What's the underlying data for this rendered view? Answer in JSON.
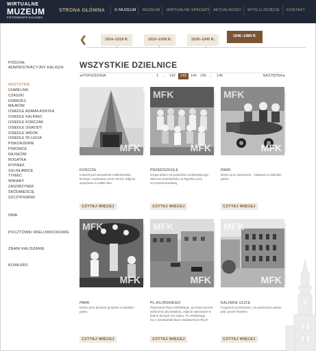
{
  "header": {
    "logo": {
      "line1": "WIRTUALNE",
      "line2": "MUZEUM",
      "line3": "FOTOGRAFII KALISZA"
    },
    "home_label": "STRONA GŁÓWNA",
    "nav": [
      {
        "label": "O MUZEUM",
        "active": true
      },
      {
        "label": "MUZEUM",
        "active": false
      },
      {
        "label": "WIRTUALNE SPACERY",
        "active": false
      },
      {
        "label": "AKTUALNOŚCI",
        "active": false
      },
      {
        "label": "WYŚLIJ ZDJĘCIE",
        "active": false
      },
      {
        "label": "KONTAKT",
        "active": false
      }
    ]
  },
  "timeline": {
    "tabs": [
      "1914–1918 R.",
      "1919–1938 R.",
      "1939–1945 R.",
      "1946–1989 R."
    ],
    "active_index": 3
  },
  "sidebar": {
    "heading": [
      "PODZIAŁ",
      "ADMINISTRACYJNY KALISZA"
    ],
    "districts": [
      "WSZYSTKIE",
      "CHMIELNIK",
      "CZASZKI",
      "DOBRZEC",
      "MAJKÓW",
      "OSIEDLE ADAMA ASNYKA",
      "OSIEDLE KALINIEC",
      "OSIEDLE KORCZAK",
      "OSIEDLE OGRODY",
      "OSIEDLE WIDOK",
      "OSIEDLE 25-LECIA",
      "PISKORZEWIE",
      "PIWONICE",
      "RAJSKÓW",
      "ROGATKA",
      "RYPINEK",
      "SULISŁAWICE",
      "TYNIEC",
      "WINIARY",
      "ZAGORZYNEK",
      "ŚRÓDMIEŚCIE",
      "SZCZYPIORNO"
    ],
    "active_district": "WSZYSTKIE",
    "links": [
      "INNE",
      "POCZTÓWKI WIELOWIDOKOWE",
      "ZNANI KALISZANIE",
      "KONKURS"
    ]
  },
  "main": {
    "title": "WSZYSTKIE DZIELNICE",
    "pager": {
      "prev": "◂ POPRZEDNIA",
      "next": "NASTĘPNA ▸",
      "pages": [
        "1",
        "...",
        "142",
        "143",
        "144",
        "145",
        "...",
        "146"
      ],
      "current": "143"
    },
    "watermark": "MFK",
    "button_label": "CZYTAJ WIĘCEJ",
    "items": [
      {
        "title": "KOŚCIÓŁ",
        "desc": "Kościół pod wezwaniem Miłosierdzia Bożego, budowany przez 30 lat. Zdjęcie wykonane w 1988 roku."
      },
      {
        "title": "PRZEDSZKOLE",
        "desc": "Grupa dzieci na podwórku nieistniejącego obecnie przedszkola na Rypinku przy ul.Częstochowskiej."
      },
      {
        "title": "PARK",
        "desc": "Dzieci przy samolocie - zabawce w kaliskim parku."
      },
      {
        "title": "PARK",
        "desc": "Dzieci przy planszy grzybów w kaliskim parku."
      },
      {
        "title": "PL.KILIŃSKIEGO",
        "desc": "Panorama Placu Kilińskiego, po lewej stronie widoczna ulica Babina, zdjęcie wykonane w latach 50-tych XX wieku. PL.Kilińskiego fot.A.Śmietański Biuro Wydawnicze Ruch"
      },
      {
        "title": "KALISKIE ULICE",
        "desc": "Fragment al.Wolności, na pierwszym planie plac przed Teatrem."
      }
    ]
  },
  "colors": {
    "header_bg": "#1f2636",
    "accent_brown": "#7a5433",
    "nav_text": "#b8a788",
    "active_district": "#c46a2a",
    "button_bg": "#efe9df"
  }
}
